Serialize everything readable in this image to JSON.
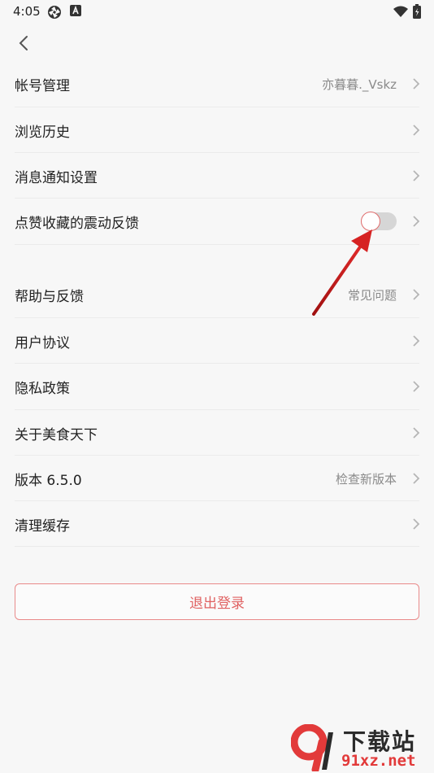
{
  "status_bar": {
    "time": "4:05",
    "icons": [
      "aperture-icon",
      "a-badge-icon",
      "wifi-icon",
      "battery-icon"
    ]
  },
  "nav": {
    "back_icon": "chevron-left-icon"
  },
  "settings_group_1": [
    {
      "label": "帐号管理",
      "value": "亦暮暮._Vskz"
    },
    {
      "label": "浏览历史",
      "value": ""
    },
    {
      "label": "消息通知设置",
      "value": ""
    },
    {
      "label": "点赞收藏的震动反馈",
      "toggle_on": false
    }
  ],
  "settings_group_2": [
    {
      "label": "帮助与反馈",
      "value": "常见问题"
    },
    {
      "label": "用户协议",
      "value": ""
    },
    {
      "label": "隐私政策",
      "value": ""
    },
    {
      "label": "关于美食天下",
      "value": ""
    },
    {
      "label": "版本 6.5.0",
      "value": "检查新版本"
    },
    {
      "label": "清理缓存",
      "value": ""
    }
  ],
  "logout": {
    "label": "退出登录"
  },
  "watermark": {
    "main": "下载站",
    "sub": "91xz.net",
    "logo_text": "9"
  },
  "colors": {
    "background": "#f7f7f7",
    "accent": "#e06262",
    "annotation_arrow": "#cc1f1f",
    "toggle_track": "#d6d6d6"
  }
}
